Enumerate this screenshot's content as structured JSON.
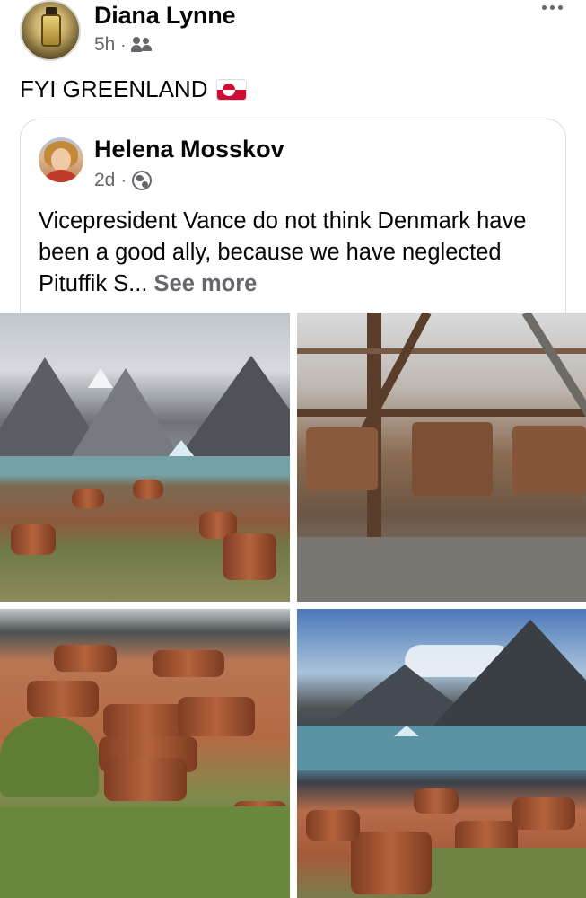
{
  "post": {
    "author": "Diana Lynne",
    "time": "5h",
    "separator": "·",
    "audience_icon": "group-icon",
    "text": "FYI GREENLAND",
    "flag_icon": "greenland-flag-icon",
    "more_icon": "more-options-icon"
  },
  "shared": {
    "author": "Helena Mosskov",
    "time": "2d",
    "separator": "·",
    "audience_icon": "globe-icon",
    "text": "Vicepresident Vance do not think Denmark have been a good ally, because we have neglected Pituffik S...",
    "see_more": "See more"
  },
  "photos": [
    {
      "name": "photo-fjord-barrels"
    },
    {
      "name": "photo-abandoned-trucks"
    },
    {
      "name": "photo-rusted-barrels"
    },
    {
      "name": "photo-coast-barrels"
    }
  ],
  "colors": {
    "text_primary": "#050505",
    "text_secondary": "#65676b",
    "card_border": "#dadde1",
    "flag_red": "#d00c33"
  }
}
